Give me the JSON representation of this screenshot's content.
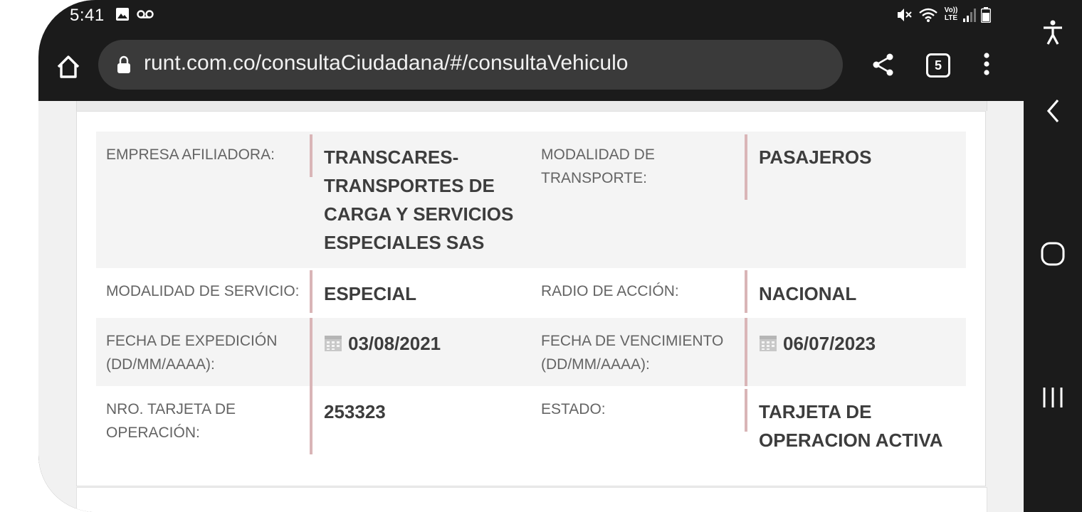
{
  "status_bar": {
    "time": "5:41",
    "left_icons": [
      "image-icon",
      "voicemail-icon"
    ],
    "right_icons": [
      "mute-icon",
      "wifi-icon",
      "volte-icon",
      "signal-icon",
      "battery-icon"
    ],
    "volte_label_top": "Vo))",
    "volte_label_bottom": "LTE"
  },
  "browser": {
    "url": "runt.com.co/consultaCiudadana/#/consultaVehiculo",
    "tab_count": "5"
  },
  "fields": [
    {
      "left_label": "EMPRESA AFILIADORA:",
      "left_value": "TRANSCARES-TRANSPORTES DE CARGA Y SERVICIOS ESPECIALES SAS",
      "right_label": "MODALIDAD DE TRANSPORTE:",
      "right_value": "PASAJEROS"
    },
    {
      "left_label": "MODALIDAD DE SERVICIO:",
      "left_value": "ESPECIAL",
      "right_label": "RADIO DE ACCIÓN:",
      "right_value": "NACIONAL"
    },
    {
      "left_label": "FECHA DE EXPEDICIÓN (DD/MM/AAAA):",
      "left_value": "03/08/2021",
      "right_label": "FECHA DE VENCIMIENTO (DD/MM/AAAA):",
      "right_value": "06/07/2023"
    },
    {
      "left_label": "NRO. TARJETA DE OPERACIÓN:",
      "left_value": "253323",
      "right_label": "ESTADO:",
      "right_value": "TARJETA DE OPERACION ACTIVA"
    }
  ],
  "colors": {
    "accent_bar": "#d9b5b7",
    "row_shade": "#f4f4f4",
    "label_text": "#646464",
    "value_text": "#3d3d3d",
    "chrome": "#1b1b1b"
  },
  "nav_icons": [
    "accessibility-icon",
    "back-icon",
    "home-icon",
    "recents-icon"
  ]
}
